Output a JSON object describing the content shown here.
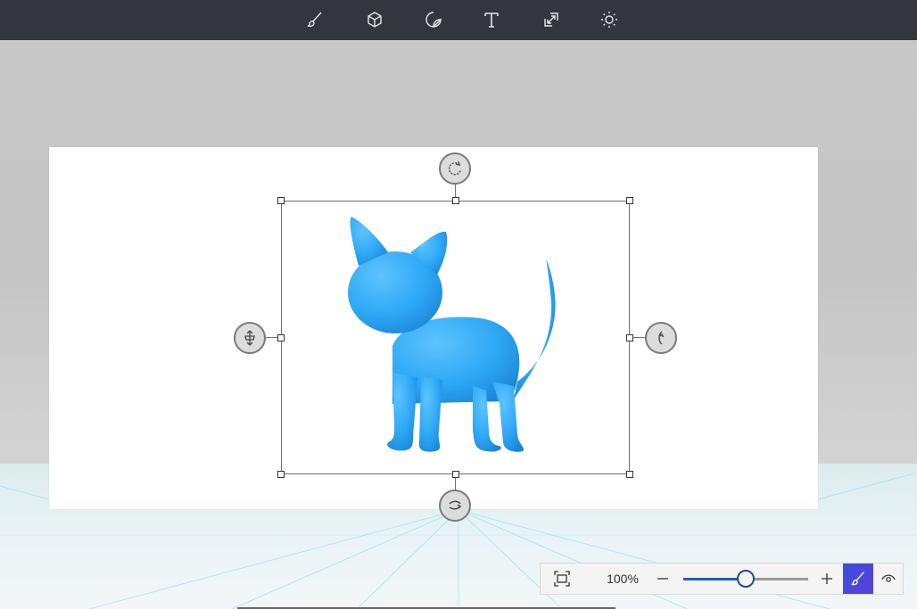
{
  "toolbar": {
    "tools": [
      {
        "name": "brushes",
        "icon": "brush-icon"
      },
      {
        "name": "3d-shapes",
        "icon": "cube-icon"
      },
      {
        "name": "stickers",
        "icon": "sticker-icon"
      },
      {
        "name": "text",
        "icon": "text-icon"
      },
      {
        "name": "canvas",
        "icon": "resize-canvas-icon"
      },
      {
        "name": "effects",
        "icon": "sun-icon"
      }
    ]
  },
  "canvas": {
    "object": {
      "name": "cat",
      "color": "#2ea7f5",
      "controls": [
        "rotate-z-icon",
        "rotate-x-icon",
        "rotate-y-icon",
        "depth-icon"
      ]
    }
  },
  "zoom": {
    "percent": "100%",
    "level": 0.5,
    "accent": "#1f5fbf"
  },
  "colors": {
    "toolbar_bg": "#33363d",
    "active_button": "#4a45dc"
  }
}
